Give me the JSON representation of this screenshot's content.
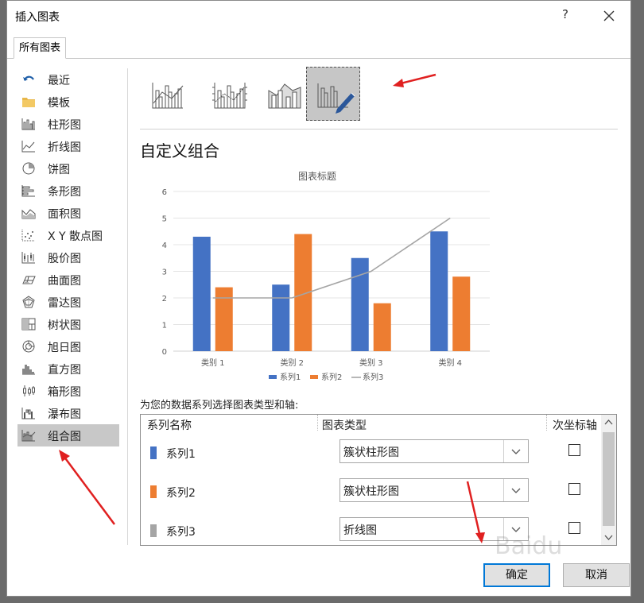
{
  "dialog": {
    "title": "插入图表",
    "help_label": "?"
  },
  "tabs": [
    {
      "label": "所有图表"
    }
  ],
  "sidebar": {
    "items": [
      {
        "label": "最近",
        "icon": "undo-arrow-icon"
      },
      {
        "label": "模板",
        "icon": "folder-icon"
      },
      {
        "label": "柱形图",
        "icon": "column-chart-icon"
      },
      {
        "label": "折线图",
        "icon": "line-chart-icon"
      },
      {
        "label": "饼图",
        "icon": "pie-chart-icon"
      },
      {
        "label": "条形图",
        "icon": "bar-chart-icon"
      },
      {
        "label": "面积图",
        "icon": "area-chart-icon"
      },
      {
        "label": "X Y 散点图",
        "icon": "scatter-chart-icon"
      },
      {
        "label": "股价图",
        "icon": "stock-chart-icon"
      },
      {
        "label": "曲面图",
        "icon": "surface-chart-icon"
      },
      {
        "label": "雷达图",
        "icon": "radar-chart-icon"
      },
      {
        "label": "树状图",
        "icon": "treemap-chart-icon"
      },
      {
        "label": "旭日图",
        "icon": "sunburst-chart-icon"
      },
      {
        "label": "直方图",
        "icon": "histogram-chart-icon"
      },
      {
        "label": "箱形图",
        "icon": "box-whisker-chart-icon"
      },
      {
        "label": "瀑布图",
        "icon": "waterfall-chart-icon"
      },
      {
        "label": "组合图",
        "icon": "combo-chart-icon",
        "active": true
      }
    ]
  },
  "subtypes": [
    {
      "name": "clustered-column-line-icon",
      "selected": false
    },
    {
      "name": "clustered-column-line-secondary-axis-icon",
      "selected": false
    },
    {
      "name": "stacked-area-clustered-column-icon",
      "selected": false
    },
    {
      "name": "custom-combination-icon",
      "selected": true
    }
  ],
  "section_title": "自定义组合",
  "chart_data": {
    "type": "bar",
    "title": "图表标题",
    "categories": [
      "类别 1",
      "类别 2",
      "类别 3",
      "类别 4"
    ],
    "series": [
      {
        "name": "系列1",
        "type": "bar",
        "values": [
          4.3,
          2.5,
          3.5,
          4.5
        ],
        "color": "#4472c4"
      },
      {
        "name": "系列2",
        "type": "bar",
        "values": [
          2.4,
          4.4,
          1.8,
          2.8
        ],
        "color": "#ed7d31"
      },
      {
        "name": "系列3",
        "type": "line",
        "values": [
          2,
          2,
          3,
          5
        ],
        "color": "#a5a5a5"
      }
    ],
    "ylim": [
      0,
      6
    ],
    "yticks": [
      "0",
      "1",
      "2",
      "3",
      "4",
      "5",
      "6"
    ],
    "grid": true,
    "legend": "bottom"
  },
  "instruction": "为您的数据系列选择图表类型和轴:",
  "table": {
    "headers": {
      "series_name": "系列名称",
      "chart_type": "图表类型",
      "secondary_axis": "次坐标轴"
    },
    "rows": [
      {
        "name": "系列1",
        "type": "簇状柱形图",
        "secondary": false,
        "color": "#4472c4"
      },
      {
        "name": "系列2",
        "type": "簇状柱形图",
        "secondary": false,
        "color": "#ed7d31"
      },
      {
        "name": "系列3",
        "type": "折线图",
        "secondary": false,
        "color": "#a5a5a5"
      }
    ]
  },
  "buttons": {
    "ok": "确定",
    "cancel": "取消"
  },
  "watermark": "Baidu"
}
